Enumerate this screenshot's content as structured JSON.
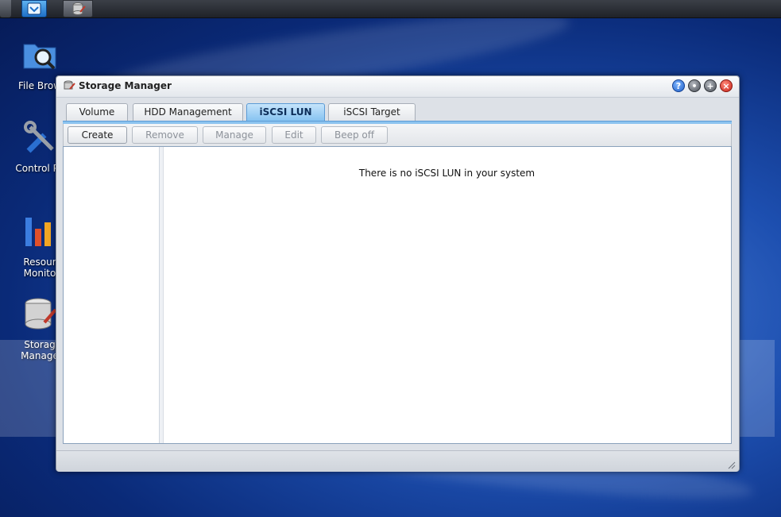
{
  "taskbar": {
    "start_icon": "chevron-down-icon",
    "app_icon": "storage-manager-icon"
  },
  "desktop": {
    "icons": [
      {
        "label": "File Brow",
        "icon": "file-browser-icon"
      },
      {
        "label": "Control Pa",
        "icon": "control-panel-icon"
      },
      {
        "label": "Resour\nMonito",
        "icon": "resource-monitor-icon"
      },
      {
        "label": "Storag\nManage",
        "icon": "storage-manager-icon"
      }
    ]
  },
  "window": {
    "title": "Storage Manager",
    "controls": [
      "help-icon",
      "minimize-icon",
      "maximize-icon",
      "close-icon"
    ],
    "tabs": [
      {
        "label": "Volume",
        "active": false
      },
      {
        "label": "HDD Management",
        "active": false
      },
      {
        "label": "iSCSI LUN",
        "active": true
      },
      {
        "label": "iSCSI Target",
        "active": false
      }
    ],
    "toolbar": {
      "create": "Create",
      "remove": "Remove",
      "manage": "Manage",
      "edit": "Edit",
      "beep_off": "Beep off"
    },
    "empty_message": "There is no iSCSI LUN in your system"
  },
  "colors": {
    "active_tab": "#86c3f1",
    "close_button": "#c8231a",
    "help_button": "#1f5fc8"
  }
}
